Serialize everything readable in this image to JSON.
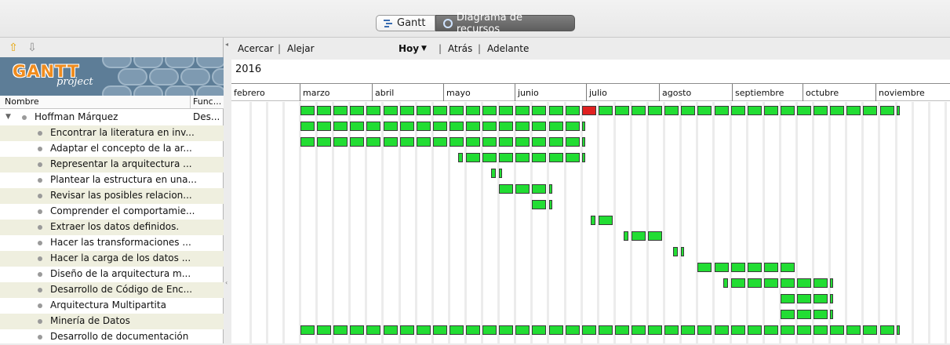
{
  "tabs": {
    "gantt_label": "Gantt",
    "resources_label": "Diagrama de recursos",
    "active": "resources"
  },
  "logo": {
    "line1": "GANTT",
    "line2": "project"
  },
  "tree": {
    "columns": [
      "Nombre",
      "Func..."
    ],
    "resource": {
      "name": "Hoffman Márquez",
      "function": "Des..."
    },
    "tasks": [
      "Encontrar la literatura en inv...",
      "Adaptar el concepto de la ar...",
      "Representar la arquitectura ...",
      "Plantear la estructura en una...",
      "Revisar las posibles relacion...",
      "Comprender el comportamie...",
      "Extraer los datos definidos.",
      "Hacer las transformaciones ...",
      "Hacer la carga de los datos ...",
      "Diseño de la arquitectura m...",
      "Desarrollo de Código de Enc...",
      "Arquitectura Multipartita",
      "Minería de Datos",
      "Desarrollo de documentación"
    ]
  },
  "toolbar": {
    "zoom_in": "Acercar",
    "zoom_out": "Alejar",
    "today": "Hoy",
    "back": "Atrás",
    "forward": "Adelante"
  },
  "timeline": {
    "year": "2016",
    "months": [
      "febrero",
      "marzo",
      "abril",
      "mayo",
      "junio",
      "julio",
      "agosto",
      "septiembre",
      "octubre",
      "noviembre"
    ]
  },
  "colors": {
    "load_normal": "#22dd33",
    "load_overload": "#e02020",
    "weekend_stripe": "#ececec",
    "row_alt": "#efefdf"
  }
}
